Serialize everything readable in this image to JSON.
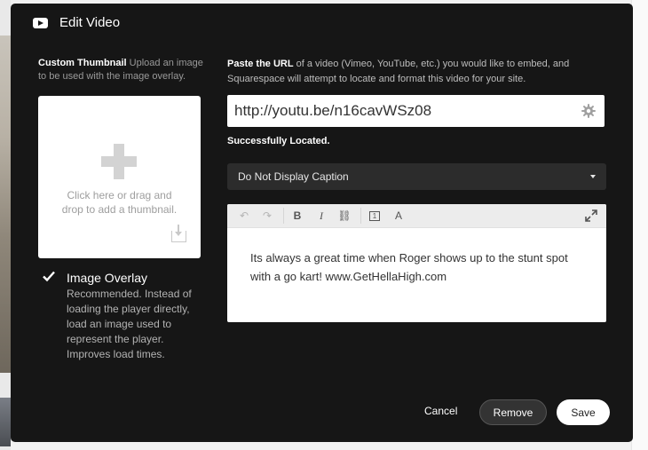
{
  "dialog": {
    "title": "Edit Video",
    "icon": "youtube-icon"
  },
  "thumbnail": {
    "heading": "Custom Thumbnail",
    "description": "Upload an image to be used with the image overlay.",
    "dropzone_text": "Click here or drag and drop to add a thumbnail.",
    "icons": [
      "plus-icon",
      "upload-icon"
    ]
  },
  "overlay": {
    "checked": true,
    "title": "Image Overlay",
    "description": "Recommended. Instead of loading the player directly, load an image used to represent the player. Improves load times."
  },
  "url": {
    "description_bold": "Paste the URL",
    "description_rest": "of a video (Vimeo, YouTube, etc.) you would like to embed, and Squarespace will attempt to locate and format this video for your site.",
    "value": "http://youtu.be/n16cavWSz08",
    "status": "Successfully Located."
  },
  "caption_select": {
    "selected": "Do Not Display Caption"
  },
  "editor": {
    "toolbar": [
      {
        "name": "undo",
        "glyph": "↶"
      },
      {
        "name": "redo",
        "glyph": "↷"
      },
      {
        "name": "bold",
        "glyph": "B"
      },
      {
        "name": "italic",
        "glyph": "I"
      },
      {
        "name": "link",
        "glyph": "⛓"
      },
      {
        "name": "format",
        "glyph": "1"
      },
      {
        "name": "text-size",
        "glyph": "A"
      }
    ],
    "content": "Its always a great time when Roger shows up to the stunt spot with a go kart! www.GetHellaHigh.com"
  },
  "footer": {
    "cancel": "Cancel",
    "remove": "Remove",
    "save": "Save"
  },
  "colors": {
    "dialog_bg": "#161616",
    "select_bg": "#2c2c2c",
    "toolbar_bg": "#ececec"
  }
}
